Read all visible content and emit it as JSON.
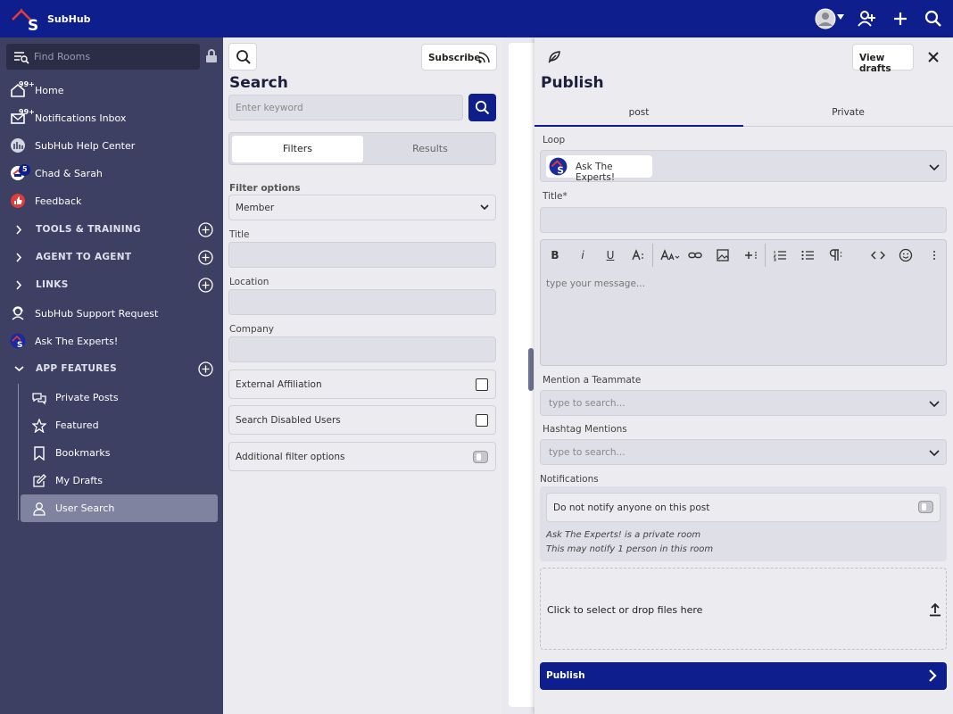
{
  "app": {
    "name": "SubHub"
  },
  "sidebar": {
    "find_placeholder": "Find Rooms",
    "items": [
      {
        "label": "Home",
        "badge": "99+"
      },
      {
        "label": "Notifications Inbox",
        "badge": "99+"
      },
      {
        "label": "SubHub Help Center"
      },
      {
        "label": "Chad & Sarah",
        "badge": "5"
      },
      {
        "label": "Feedback"
      },
      {
        "label": "TOOLS & TRAINING"
      },
      {
        "label": "AGENT TO AGENT"
      },
      {
        "label": "LINKS"
      },
      {
        "label": "SubHub Support Request"
      },
      {
        "label": "Ask The Experts!"
      },
      {
        "label": "APP FEATURES"
      }
    ],
    "sub_items": [
      {
        "label": "Private Posts"
      },
      {
        "label": "Featured"
      },
      {
        "label": "Bookmarks"
      },
      {
        "label": "My Drafts"
      },
      {
        "label": "User Search",
        "active": true
      }
    ]
  },
  "search": {
    "subscribe_label": "Subscribe",
    "title": "Search",
    "keyword_placeholder": "Enter keyword",
    "tabs": [
      "Filters",
      "Results"
    ],
    "filter_options_label": "Filter options",
    "member_select": "Member",
    "title_label": "Title",
    "location_label": "Location",
    "company_label": "Company",
    "external_affiliation": "External Affiliation",
    "search_disabled": "Search Disabled Users",
    "additional_filters": "Additional filter options"
  },
  "publish": {
    "view_drafts": "View drafts",
    "title": "Publish",
    "tabs": [
      "post",
      "Private"
    ],
    "loop_label": "Loop",
    "loop_value": "Ask The Experts!",
    "title_label": "Title*",
    "message_placeholder": "type your message...",
    "mention_label": "Mention a Teammate",
    "mention_placeholder": "type to search...",
    "hashtag_label": "Hashtag Mentions",
    "hashtag_placeholder": "type to search...",
    "notifications_label": "Notifications",
    "no_notify": "Do not notify anyone on this post",
    "private_note": "Ask The Experts! is a private room",
    "notify_note": "This may notify 1 person in this room",
    "dropzone": "Click to select or drop files here",
    "publish_button": "Publish",
    "toolbar_glyphs": {
      "bold": "B",
      "italic": "i",
      "underline": "U"
    }
  },
  "colors": {
    "brand": "#0e1e8c",
    "sidebar": "#3d4062",
    "panel": "#ebebf0"
  }
}
